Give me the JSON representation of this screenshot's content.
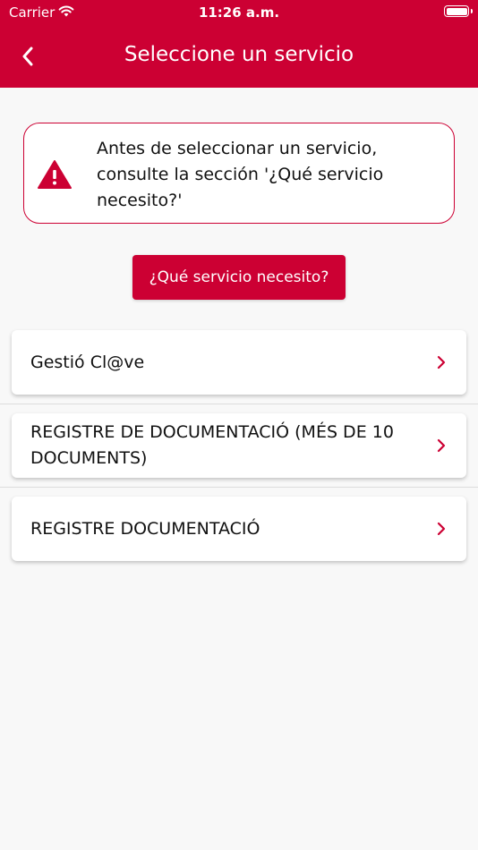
{
  "status_bar": {
    "carrier": "Carrier",
    "time": "11:26 a.m."
  },
  "header": {
    "title": "Seleccione un servicio",
    "back_icon": "chevron-left-icon"
  },
  "warning": {
    "icon": "warning-icon",
    "text": "Antes de seleccionar un servicio, consulte la sección '¿Qué servicio necesito?'"
  },
  "help_button": {
    "label": "¿Qué servicio necesito?"
  },
  "services": [
    {
      "label": "Gestió Cl@ve"
    },
    {
      "label": "REGISTRE DE DOCUMENTACIÓ (MÉS DE 10 DOCUMENTS)"
    },
    {
      "label": "REGISTRE DOCUMENTACIÓ"
    }
  ],
  "colors": {
    "brand": "#cc0033",
    "background": "#f8f8f8"
  }
}
